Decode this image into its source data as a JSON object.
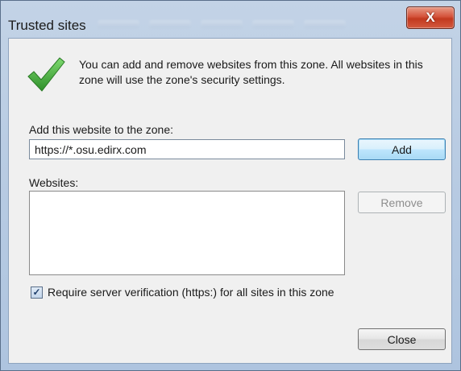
{
  "window": {
    "title": "Trusted sites",
    "close_glyph": "X"
  },
  "intro": {
    "icon": "green-checkmark-icon",
    "text": "You can add and remove websites from this zone. All websites in this zone will use the zone's security settings."
  },
  "add_site": {
    "label": "Add this website to the zone:",
    "value": "https://*.osu.edirx.com",
    "button": "Add"
  },
  "websites": {
    "label": "Websites:",
    "items": [],
    "remove_button": "Remove"
  },
  "verification": {
    "checked": true,
    "label": "Require server verification (https:) for all sites in this zone"
  },
  "footer": {
    "close_button": "Close"
  },
  "colors": {
    "title_bar": "#b9cce3",
    "dialog_bg": "#f0f0f0",
    "close_button_red": "#c2391f",
    "check_green": "#3aa534"
  }
}
